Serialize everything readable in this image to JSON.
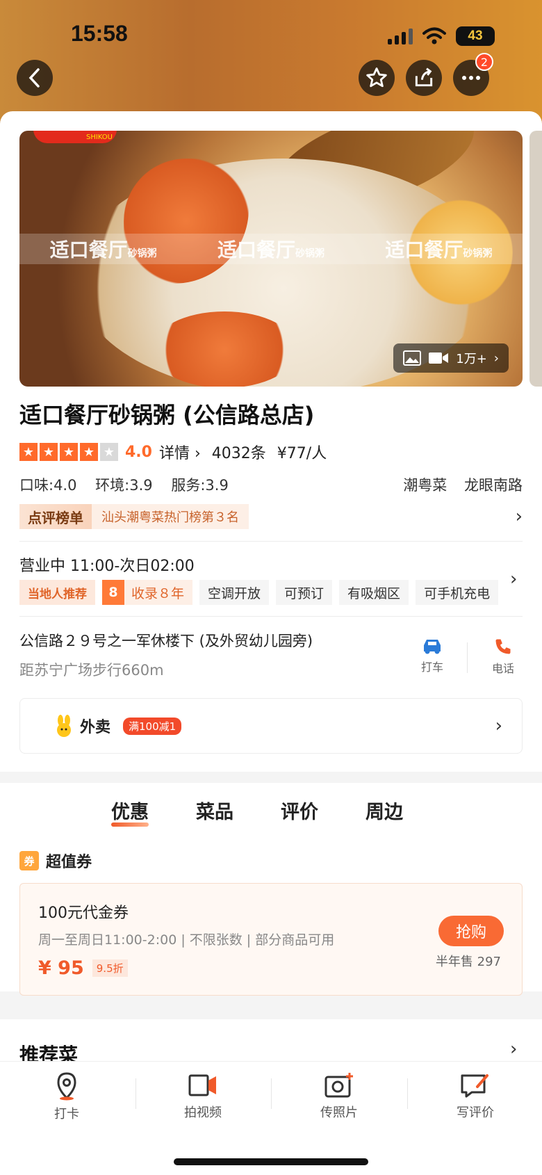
{
  "status_bar": {
    "time": "15:58",
    "battery": "43"
  },
  "nav": {
    "badge_count": "2"
  },
  "hero": {
    "watermark_main": "适口餐厅",
    "watermark_sub": "砂锅粥",
    "logo_text": "SHIKOU",
    "media_count": "1万+"
  },
  "restaurant": {
    "name": "适口餐厅砂锅粥 (公信路总店)",
    "score": "4.0",
    "details_link": "详情",
    "review_count": "4032条",
    "price_per_person": "¥77/人",
    "sub_scores": [
      "口味:4.0",
      "环境:3.9",
      "服务:3.9"
    ],
    "cuisine": "潮粤菜",
    "area": "龙眼南路",
    "rank_tag": "点评榜单",
    "rank_text": "汕头潮粤菜热门榜第３名",
    "hours": "营业中 11:00-次日02:00",
    "tag_local": "当地人推荐",
    "tag_years_num": "8",
    "tag_years_text": "收录８年",
    "tags": [
      "空调开放",
      "可预订",
      "有吸烟区",
      "可手机充电"
    ],
    "address": "公信路２９号之一军休楼下 (及外贸幼儿园旁)",
    "distance": "距苏宁广场步行660m",
    "taxi_label": "打车",
    "phone_label": "电话"
  },
  "takeout": {
    "label": "外卖",
    "promo": "满100减1"
  },
  "tabs": [
    "优惠",
    "菜品",
    "评价",
    "周边"
  ],
  "voucher_section": {
    "icon": "券",
    "title": "超值券",
    "voucher_title": "100元代金券",
    "desc": "周一至周日11:00-2:00 | 不限张数 | 部分商品可用",
    "price": "¥ 95",
    "discount": "9.5折",
    "buy_label": "抢购",
    "sold": "半年售 297"
  },
  "recommend": {
    "title": "推荐菜"
  },
  "bottom_bar": [
    "打卡",
    "拍视频",
    "传照片",
    "写评价"
  ],
  "colors": {
    "accent": "#ff6a2b",
    "promo_red": "#f24a2a",
    "taxi_blue": "#2b7bd8"
  }
}
